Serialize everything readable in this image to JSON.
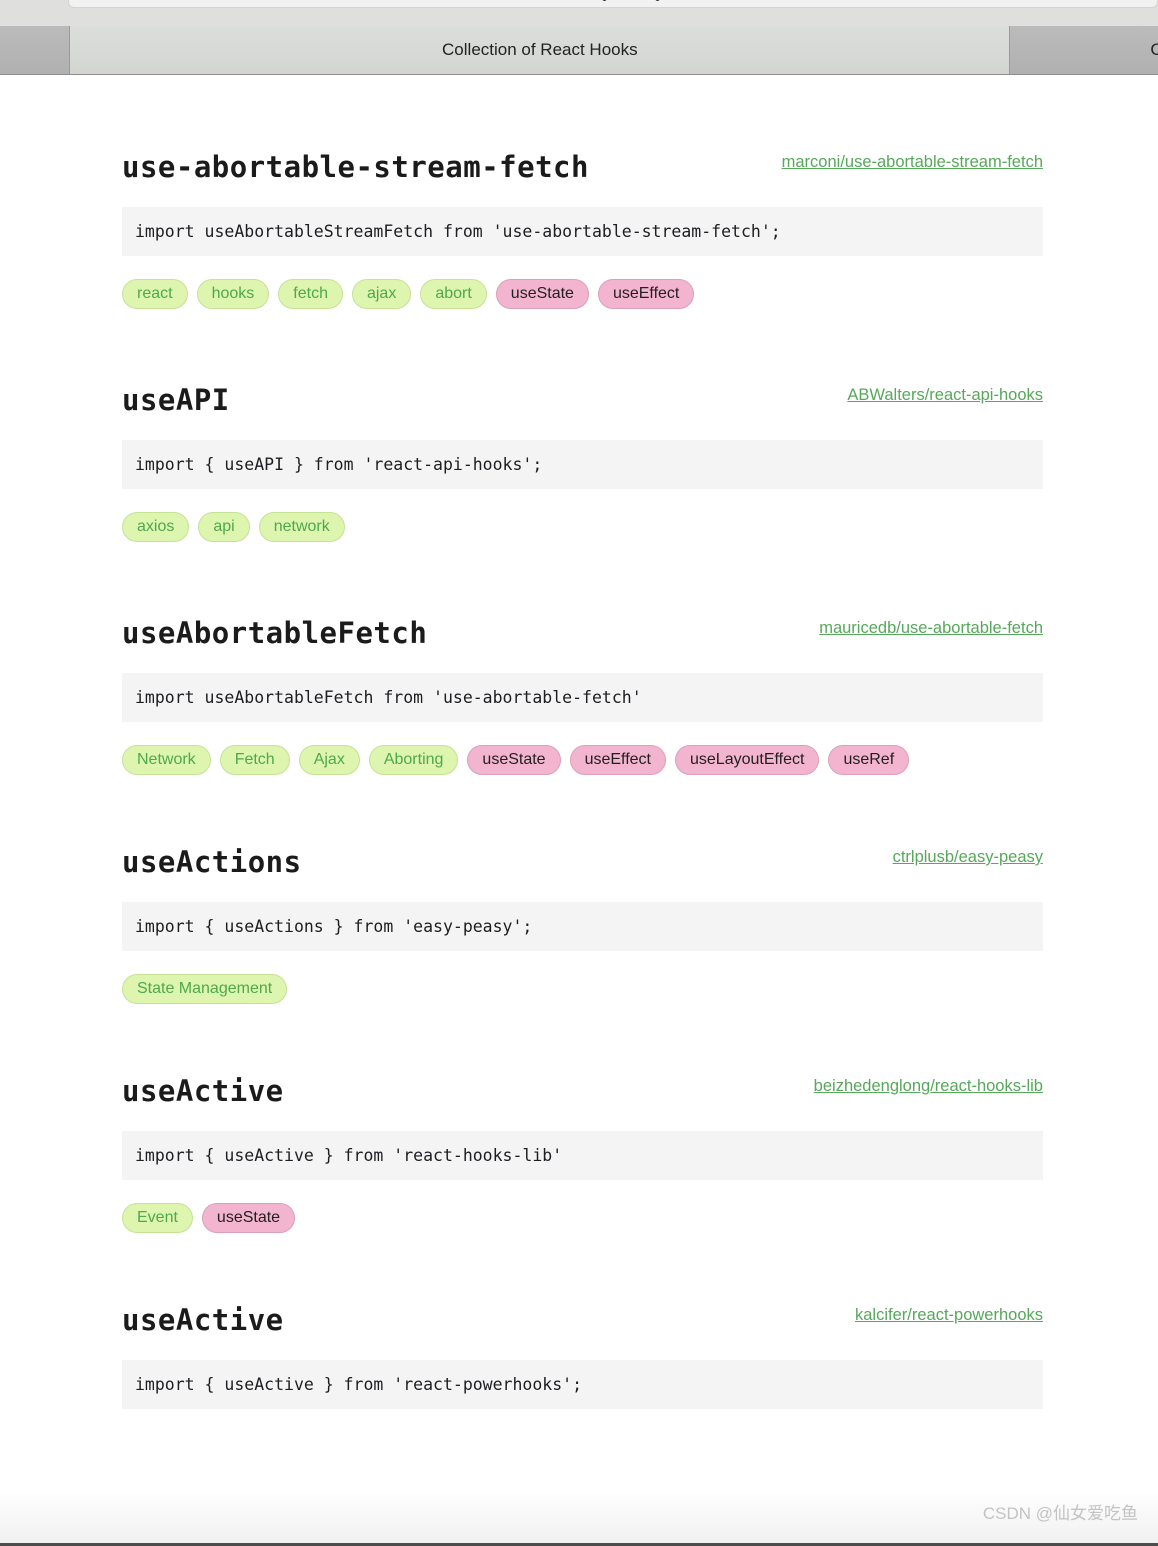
{
  "browser": {
    "tabs": [
      {
        "label": "",
        "state": "inactive"
      },
      {
        "label": "Collection of React Hooks",
        "state": "active"
      },
      {
        "label": "C",
        "state": "partial"
      }
    ]
  },
  "watermark": "CSDN @仙女爱吃鱼",
  "hooks": [
    {
      "name": "use-abortable-stream-fetch",
      "repo": "marconi/use-abortable-stream-fetch",
      "code": "import useAbortableStreamFetch from 'use-abortable-stream-fetch';",
      "tags": [
        {
          "label": "react",
          "kind": "green"
        },
        {
          "label": "hooks",
          "kind": "green"
        },
        {
          "label": "fetch",
          "kind": "green"
        },
        {
          "label": "ajax",
          "kind": "green"
        },
        {
          "label": "abort",
          "kind": "green"
        },
        {
          "label": "useState",
          "kind": "pink"
        },
        {
          "label": "useEffect",
          "kind": "pink"
        }
      ]
    },
    {
      "name": "useAPI",
      "repo": "ABWalters/react-api-hooks",
      "code": "import { useAPI } from 'react-api-hooks';",
      "tags": [
        {
          "label": "axios",
          "kind": "green"
        },
        {
          "label": "api",
          "kind": "green"
        },
        {
          "label": "network",
          "kind": "green"
        }
      ]
    },
    {
      "name": "useAbortableFetch",
      "repo": "mauricedb/use-abortable-fetch",
      "code": "import useAbortableFetch from 'use-abortable-fetch'",
      "tags": [
        {
          "label": "Network",
          "kind": "green"
        },
        {
          "label": "Fetch",
          "kind": "green"
        },
        {
          "label": "Ajax",
          "kind": "green"
        },
        {
          "label": "Aborting",
          "kind": "green"
        },
        {
          "label": "useState",
          "kind": "pink"
        },
        {
          "label": "useEffect",
          "kind": "pink"
        },
        {
          "label": "useLayoutEffect",
          "kind": "pink"
        },
        {
          "label": "useRef",
          "kind": "pink"
        }
      ]
    },
    {
      "name": "useActions",
      "repo": "ctrlplusb/easy-peasy",
      "code": "import { useActions } from 'easy-peasy';",
      "tags": [
        {
          "label": "State Management",
          "kind": "green"
        }
      ]
    },
    {
      "name": "useActive",
      "repo": "beizhedenglong/react-hooks-lib",
      "code": "import { useActive } from 'react-hooks-lib'",
      "tags": [
        {
          "label": "Event",
          "kind": "green"
        },
        {
          "label": "useState",
          "kind": "pink"
        }
      ]
    },
    {
      "name": "useActive",
      "repo": "kalcifer/react-powerhooks",
      "code": "import { useActive } from 'react-powerhooks';",
      "tags": []
    }
  ],
  "colors": {
    "tag_green_bg": "#ddf5ae",
    "tag_green_text": "#4fa84f",
    "tag_pink_bg": "#f2b4ce",
    "tag_pink_text": "#231f20",
    "repo_link": "#56a85a",
    "code_bg": "#f4f4f4"
  }
}
